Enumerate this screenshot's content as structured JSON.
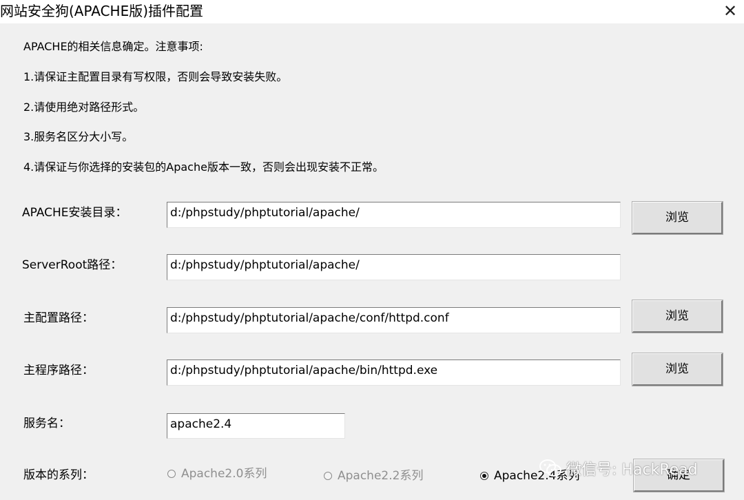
{
  "window": {
    "title": "网站安全狗(APACHE版)插件配置",
    "close_glyph": "✕"
  },
  "notes": [
    "APACHE的相关信息确定。注意事项:",
    "1.请保证主配置目录有写权限，否则会导致安装失败。",
    "2.请使用绝对路径形式。",
    "3.服务名区分大小写。",
    "4.请保证与你选择的安装包的Apache版本一致，否则会出现安装不正常。"
  ],
  "form": {
    "apache_dir": {
      "label": "APACHE安装目录：",
      "value": "d:/phpstudy/phptutorial/apache/"
    },
    "server_root": {
      "label": "ServerRoot路径：",
      "value": "d:/phpstudy/phptutorial/apache/"
    },
    "main_config": {
      "label": "主配置路径：",
      "value": "d:/phpstudy/phptutorial/apache/conf/httpd.conf"
    },
    "main_program": {
      "label": "主程序路径：",
      "value": "d:/phpstudy/phptutorial/apache/bin/httpd.exe"
    },
    "service_name": {
      "label": "服务名：",
      "value": "apache2.4"
    },
    "browse_label": "浏览",
    "version_series": {
      "label": "版本的系列：",
      "options": [
        {
          "label": "Apache2.0系列",
          "state": "disabled"
        },
        {
          "label": "Apache2.2系列",
          "state": "disabled"
        },
        {
          "label": "Apache2.4系列",
          "state": "checked"
        }
      ]
    },
    "ok_label": "确定"
  },
  "watermark": {
    "text": "微信号: HackRead",
    "icon": "wechat-icon"
  }
}
